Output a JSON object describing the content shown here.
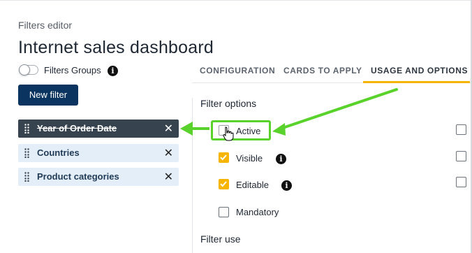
{
  "header": {
    "subtitle": "Filters editor",
    "title": "Internet sales dashboard"
  },
  "filters_groups": {
    "label": "Filters Groups",
    "enabled": false
  },
  "new_filter_label": "New filter",
  "filters": [
    {
      "name": "Year of Order Date",
      "disabled": true
    },
    {
      "name": "Countries",
      "disabled": false
    },
    {
      "name": "Product categories",
      "disabled": false
    }
  ],
  "remove_symbol": "✕",
  "tabs": [
    {
      "label": "CONFIGURATION",
      "active": false
    },
    {
      "label": "CARDS TO APPLY",
      "active": false
    },
    {
      "label": "USAGE AND OPTIONS",
      "active": true
    }
  ],
  "filter_options": {
    "heading": "Filter options",
    "options": [
      {
        "label": "Active",
        "checked": false,
        "right_checked": false
      },
      {
        "label": "Visible",
        "checked": true,
        "right_checked": false
      },
      {
        "label": "Editable",
        "checked": true,
        "right_checked": false
      },
      {
        "label": "Mandatory",
        "checked": false
      }
    ]
  },
  "filter_use_heading": "Filter use",
  "colors": {
    "accent": "#f4b400",
    "primary_button": "#0c3460",
    "annotation": "#5ad22c"
  }
}
